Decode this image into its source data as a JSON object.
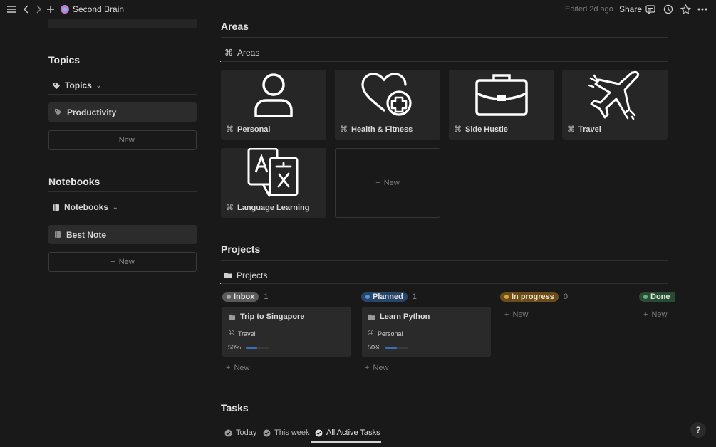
{
  "topbar": {
    "title": "Second Brain",
    "edited": "Edited 2d ago",
    "share": "Share",
    "workspace_icon_color": "#c47ad4"
  },
  "topics": {
    "heading": "Topics",
    "view_label": "Topics",
    "items": [
      {
        "label": "Productivity"
      }
    ],
    "new_label": "New"
  },
  "notebooks": {
    "heading": "Notebooks",
    "view_label": "Notebooks",
    "items": [
      {
        "label": "Best Note"
      }
    ],
    "new_label": "New"
  },
  "areas": {
    "heading": "Areas",
    "view_label": "Areas",
    "cards": [
      {
        "label": "Personal",
        "icon": "person-icon"
      },
      {
        "label": "Health & Fitness",
        "icon": "heart-plus-icon"
      },
      {
        "label": "Side Hustle",
        "icon": "briefcase-icon"
      },
      {
        "label": "Travel",
        "icon": "airplane-icon"
      },
      {
        "label": "Language Learning",
        "icon": "translate-icon"
      }
    ],
    "new_label": "New"
  },
  "projects": {
    "heading": "Projects",
    "view_label": "Projects",
    "columns": [
      {
        "status": "Inbox",
        "count": "1",
        "color": "#5a5a5a",
        "dot": "#a0a0a0"
      },
      {
        "status": "Planned",
        "count": "1",
        "color": "#28456c",
        "dot": "#5b8fd6"
      },
      {
        "status": "In progress",
        "count": "0",
        "color": "#6b4d1c",
        "dot": "#d9a441"
      },
      {
        "status": "Done",
        "count": "",
        "color": "#2b4a35",
        "dot": "#5fb27a"
      }
    ],
    "cards": [
      {
        "title": "Trip to Singapore",
        "area": "Travel",
        "progress": "50%",
        "progress_value": 0.5
      },
      {
        "title": "Learn Python",
        "area": "Personal",
        "progress": "50%",
        "progress_value": 0.5
      }
    ],
    "new_label": "New"
  },
  "tasks": {
    "heading": "Tasks",
    "tabs": [
      {
        "label": "Today"
      },
      {
        "label": "This week"
      },
      {
        "label": "All Active Tasks"
      }
    ]
  },
  "help_label": "?"
}
